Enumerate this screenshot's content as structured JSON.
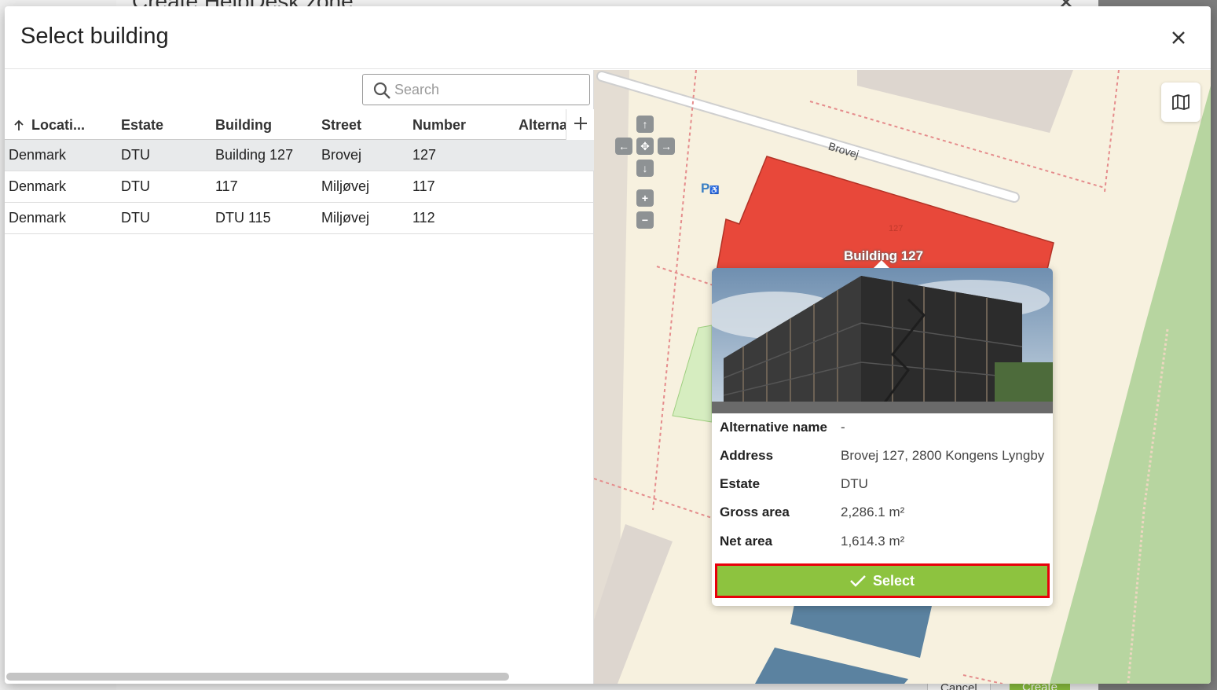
{
  "background": {
    "dialog_title": "Create HelpDesk zone",
    "cancel_label": "Cancel",
    "create_label": "Create"
  },
  "modal": {
    "title": "Select building"
  },
  "search": {
    "placeholder": "Search",
    "value": ""
  },
  "table": {
    "columns": [
      "Locati...",
      "Estate",
      "Building",
      "Street",
      "Number",
      "Alternat"
    ],
    "sort_column": "Locati...",
    "sort_direction": "ascending",
    "rows": [
      {
        "location": "Denmark",
        "estate": "DTU",
        "building": "Building 127",
        "street": "Brovej",
        "number": "127",
        "alternative": ""
      },
      {
        "location": "Denmark",
        "estate": "DTU",
        "building": "117",
        "street": "Miljøvej",
        "number": "117",
        "alternative": ""
      },
      {
        "location": "Denmark",
        "estate": "DTU",
        "building": "DTU 115",
        "street": "Miljøvej",
        "number": "112",
        "alternative": ""
      }
    ],
    "selected_row": 0
  },
  "map": {
    "street_label": "Brovej",
    "building_label": "Building 127",
    "building_number": "127",
    "parking_icon": "parking-icon",
    "layers_icon": "map-icon",
    "colors": {
      "selected_building": "#e8483a",
      "other_building": "#5b82a0",
      "green_area": "#8fbf7a"
    }
  },
  "popup": {
    "fields": [
      {
        "label": "Alternative name",
        "value": "-"
      },
      {
        "label": "Address",
        "value": "Brovej 127, 2800 Kongens Lyngby"
      },
      {
        "label": "Estate",
        "value": "DTU"
      },
      {
        "label": "Gross area",
        "value": "2,286.1 m²"
      },
      {
        "label": "Net area",
        "value": "1,614.3 m²"
      }
    ],
    "select_label": "Select"
  },
  "colors": {
    "accent_green": "#8dc33f",
    "highlight_red": "#e8000b"
  }
}
